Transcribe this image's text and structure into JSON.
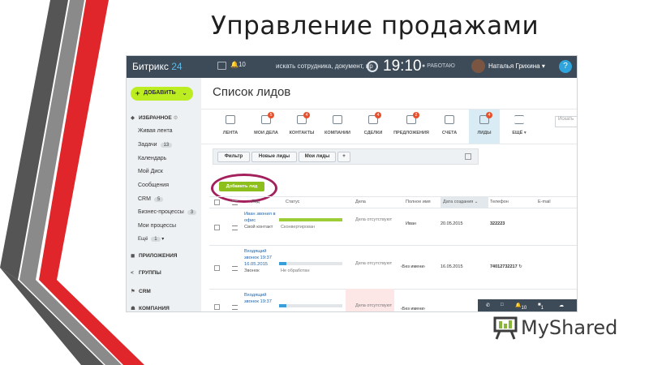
{
  "slide": {
    "title": "Управление продажами"
  },
  "topbar": {
    "logo_main": "Битрикс",
    "logo_num": "24",
    "notif_count": "10",
    "search_placeholder": "искать сотрудника, документ, пр",
    "clock": "19:10",
    "work_status": "РАБОТАЮ",
    "user_name": "Наталья Грихина",
    "help": "?"
  },
  "sidebar": {
    "add_label": "ДОБАВИТЬ",
    "favorites": "ИЗБРАННОЕ",
    "items": [
      {
        "label": "Живая лента",
        "count": ""
      },
      {
        "label": "Задачи",
        "count": "13"
      },
      {
        "label": "Календарь",
        "count": ""
      },
      {
        "label": "Мой Диск",
        "count": ""
      },
      {
        "label": "Сообщения",
        "count": ""
      },
      {
        "label": "CRM",
        "count": "5"
      },
      {
        "label": "Бизнес-процессы",
        "count": "3"
      },
      {
        "label": "Мои процессы",
        "count": ""
      },
      {
        "label": "Ещё",
        "count": "1"
      }
    ],
    "sections": [
      "ПРИЛОЖЕНИЯ",
      "ГРУППЫ",
      "CRM",
      "КОМПАНИЯ"
    ]
  },
  "main": {
    "title": "Список лидов",
    "search_placeholder": "Искать",
    "crm_buttons": [
      {
        "label": "ЛЕНТА",
        "badge": ""
      },
      {
        "label": "МОИ ДЕЛА",
        "badge": "5"
      },
      {
        "label": "КОНТАКТЫ",
        "badge": "4"
      },
      {
        "label": "КОМПАНИИ",
        "badge": ""
      },
      {
        "label": "СДЕЛКИ",
        "badge": "4"
      },
      {
        "label": "ПРЕДЛОЖЕНИЯ",
        "badge": "2"
      },
      {
        "label": "СЧЕТА",
        "badge": ""
      },
      {
        "label": "ЛИДЫ",
        "badge": "4"
      },
      {
        "label": "ЕЩЁ",
        "badge": ""
      }
    ],
    "filters": [
      "Фильтр",
      "Новые лиды",
      "Мои лиды",
      "+"
    ],
    "add_lead": "Добавить лид",
    "columns": [
      "Лид",
      "Статус",
      "Дела",
      "Полное имя",
      "Дата создания",
      "Телефон",
      "E-mail"
    ],
    "rows": [
      {
        "lead": "Иван звонил в офис",
        "lead_sub": "Свой контакт",
        "status": "Сконвертирован",
        "status_fill": 1.0,
        "status_color": "#9ccd37",
        "deals": "Дела отсутствуют",
        "name": "Иван",
        "date": "20.05.2015",
        "phone": "322223"
      },
      {
        "lead": "Входящий звонок 19:37 16.05.2015",
        "lead_sub": "Звонок",
        "status": "Не обработан",
        "status_fill": 0.12,
        "status_color": "#3a9fd8",
        "deals": "Дела отсутствуют",
        "name": "‹Без имени›",
        "date": "16.05.2015",
        "phone": "74012732217"
      },
      {
        "lead": "Входящий звонок 19:37",
        "lead_sub": "",
        "status": "Не обработан",
        "status_fill": 0.12,
        "status_color": "#3a9fd8",
        "deals": "Дела отсутствуют",
        "name": "‹Без имени›",
        "date": "",
        "phone": ""
      }
    ]
  },
  "bottombar": {
    "count_a": "10",
    "count_b": "1"
  },
  "watermark": "MyShared"
}
